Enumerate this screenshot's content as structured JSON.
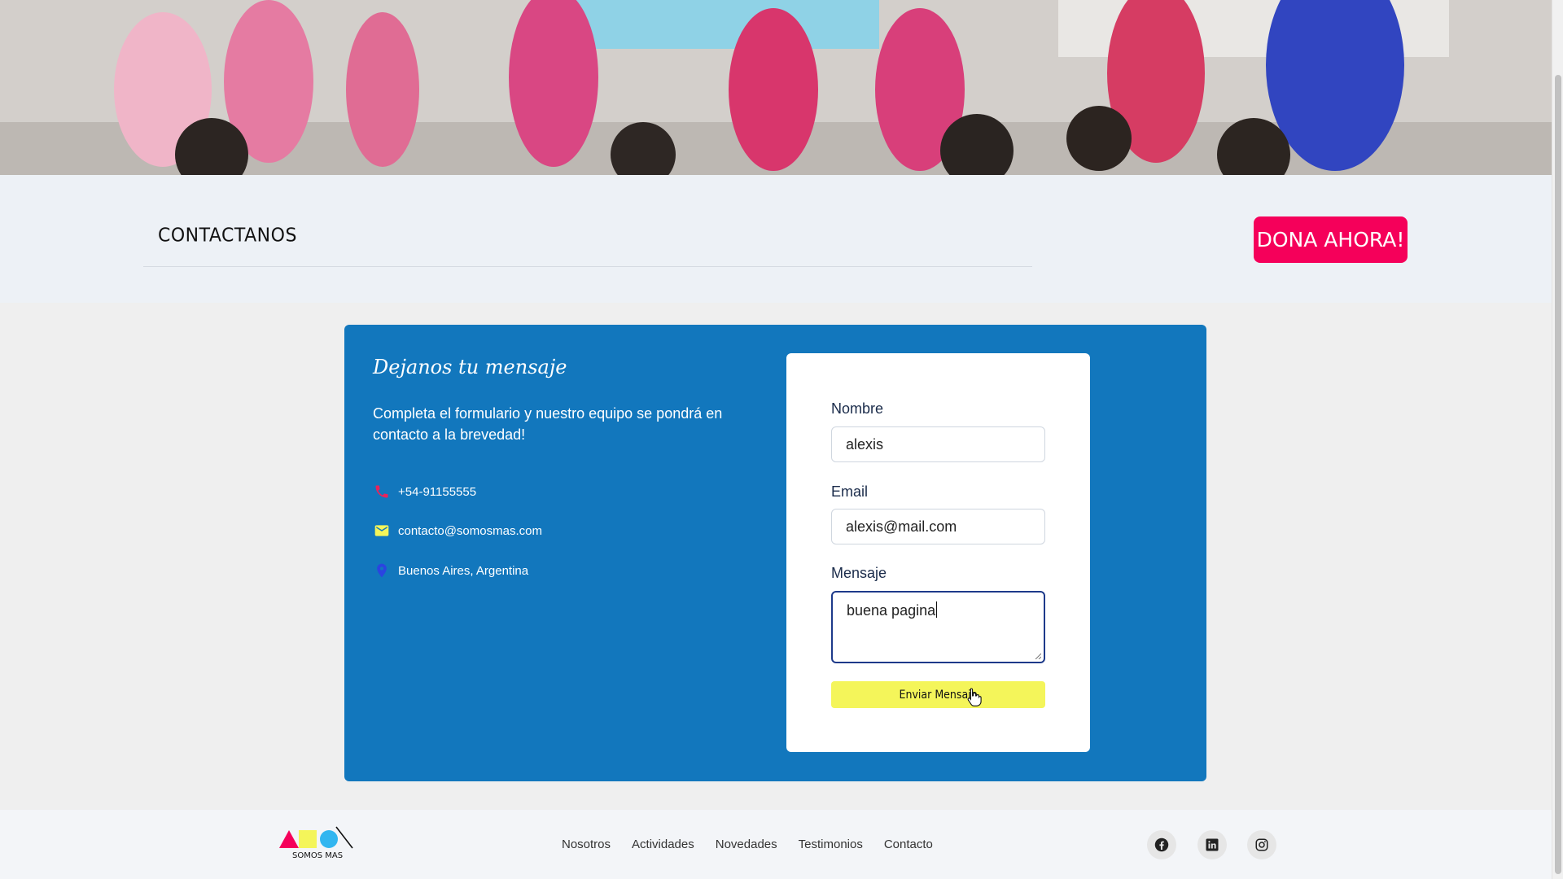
{
  "header": {
    "title": "CONTACTANOS",
    "donate_label": "DONA AHORA!"
  },
  "contact": {
    "heading": "Dejanos tu mensaje",
    "lead": "Completa el formulario y nuestro equipo se pondrá en contacto a la brevedad!",
    "phone": "+54-91155555",
    "email": "contacto@somosmas.com",
    "location": "Buenos Aires, Argentina"
  },
  "form": {
    "name_label": "Nombre",
    "name_value": "alexis",
    "email_label": "Email",
    "email_value": "alexis@mail.com",
    "message_label": "Mensaje",
    "message_value": "buena pagina",
    "submit_label": "Enviar Mensaje"
  },
  "footer": {
    "logo_text": "SOMOS MAS",
    "nav": [
      "Nosotros",
      "Actividades",
      "Novedades",
      "Testimonios",
      "Contacto"
    ],
    "social": [
      "facebook-icon",
      "linkedin-icon",
      "instagram-icon"
    ]
  },
  "colors": {
    "card_blue": "#1277bd",
    "donate_pink": "#f5005a",
    "submit_yellow": "#f4f55a",
    "phone_icon": "#e8245c",
    "mail_icon": "#f4f55a",
    "pin_icon": "#2b44e0"
  }
}
